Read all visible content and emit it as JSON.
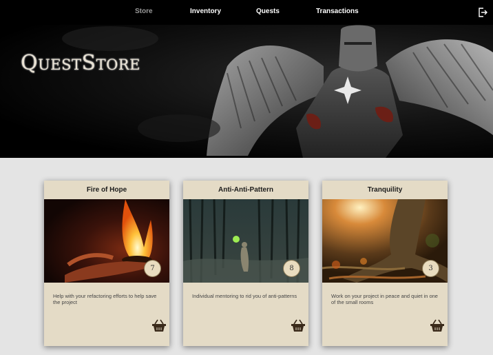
{
  "nav": {
    "items": [
      {
        "label": "Store",
        "active": true
      },
      {
        "label": "Inventory",
        "active": false
      },
      {
        "label": "Quests",
        "active": false
      },
      {
        "label": "Transactions",
        "active": false
      }
    ],
    "logout_icon": "logout-icon"
  },
  "hero": {
    "logo": "QuestStore"
  },
  "cards": [
    {
      "title": "Fire of Hope",
      "price": "7",
      "description": "Help with your refactoring efforts to help save the project",
      "icon": "basket-icon"
    },
    {
      "title": "Anti-Anti-Pattern",
      "price": "8",
      "description": "Individual mentoring to rid you of anti-patterns",
      "icon": "basket-icon"
    },
    {
      "title": "Tranquility",
      "price": "3",
      "description": "Work on your project in peace and quiet in one of the small rooms",
      "icon": "basket-icon"
    }
  ],
  "colors": {
    "nav_bg": "#000000",
    "card_bg": "#e4dbc6",
    "page_bg": "#e4e4e4",
    "active_nav": "#9a9a9a"
  }
}
